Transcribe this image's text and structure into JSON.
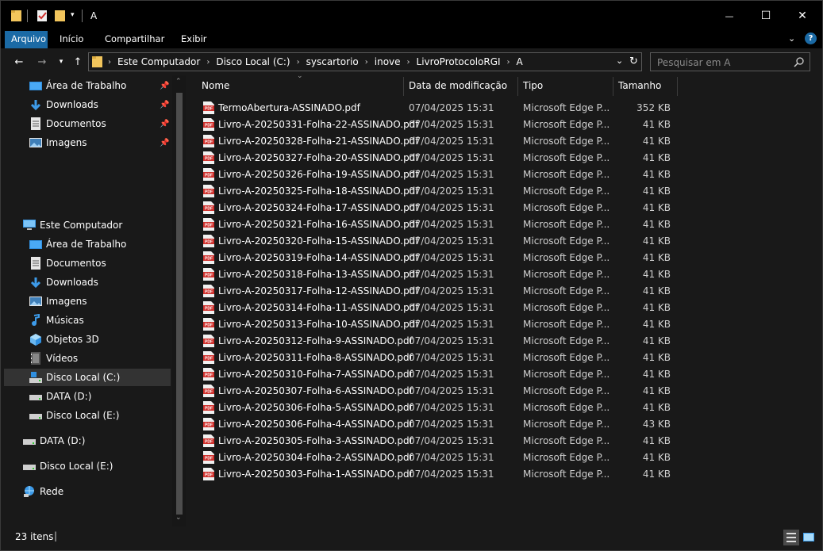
{
  "window": {
    "title": "A",
    "minimize_glyph": "—",
    "maximize_glyph": "☐",
    "close_glyph": "✕"
  },
  "ribbon": {
    "tabs": [
      {
        "label": "Arquivo",
        "active": true
      },
      {
        "label": "Início",
        "active": false
      },
      {
        "label": "Compartilhar",
        "active": false
      },
      {
        "label": "Exibir",
        "active": false
      }
    ]
  },
  "nav": {
    "breadcrumbs": [
      "Este Computador",
      "Disco Local (C:)",
      "syscartorio",
      "inove",
      "LivroProtocoloRGI",
      "A"
    ],
    "search_placeholder": "Pesquisar em A"
  },
  "sidebar": {
    "quick_access": [
      {
        "label": "Área de Trabalho",
        "icon": "desktop-icon",
        "pinned": true
      },
      {
        "label": "Downloads",
        "icon": "download-icon",
        "pinned": true
      },
      {
        "label": "Documentos",
        "icon": "documents-icon",
        "pinned": true
      },
      {
        "label": "Imagens",
        "icon": "pictures-icon",
        "pinned": true
      }
    ],
    "this_pc": {
      "label": "Este Computador",
      "icon": "computer-icon"
    },
    "this_pc_items": [
      {
        "label": "Área de Trabalho",
        "icon": "desktop-icon"
      },
      {
        "label": "Documentos",
        "icon": "documents-icon"
      },
      {
        "label": "Downloads",
        "icon": "download-icon"
      },
      {
        "label": "Imagens",
        "icon": "pictures-icon"
      },
      {
        "label": "Músicas",
        "icon": "music-icon"
      },
      {
        "label": "Objetos 3D",
        "icon": "objects-3d-icon"
      },
      {
        "label": "Vídeos",
        "icon": "videos-icon"
      },
      {
        "label": "Disco Local (C:)",
        "icon": "drive-os-icon",
        "selected": true
      },
      {
        "label": "DATA (D:)",
        "icon": "drive-icon"
      },
      {
        "label": "Disco Local (E:)",
        "icon": "drive-icon"
      }
    ],
    "roots": [
      {
        "label": "DATA (D:)",
        "icon": "drive-icon"
      },
      {
        "label": "Disco Local (E:)",
        "icon": "drive-icon"
      },
      {
        "label": "Rede",
        "icon": "network-icon"
      }
    ]
  },
  "columns": {
    "name": "Nome",
    "date": "Data de modificação",
    "type": "Tipo",
    "size": "Tamanho"
  },
  "files": [
    {
      "name": "TermoAbertura-ASSINADO.pdf",
      "date": "07/04/2025 15:31",
      "type": "Microsoft Edge P...",
      "size": "352 KB"
    },
    {
      "name": "Livro-A-20250331-Folha-22-ASSINADO.pdf",
      "date": "07/04/2025 15:31",
      "type": "Microsoft Edge P...",
      "size": "41 KB"
    },
    {
      "name": "Livro-A-20250328-Folha-21-ASSINADO.pdf",
      "date": "07/04/2025 15:31",
      "type": "Microsoft Edge P...",
      "size": "41 KB"
    },
    {
      "name": "Livro-A-20250327-Folha-20-ASSINADO.pdf",
      "date": "07/04/2025 15:31",
      "type": "Microsoft Edge P...",
      "size": "41 KB"
    },
    {
      "name": "Livro-A-20250326-Folha-19-ASSINADO.pdf",
      "date": "07/04/2025 15:31",
      "type": "Microsoft Edge P...",
      "size": "41 KB"
    },
    {
      "name": "Livro-A-20250325-Folha-18-ASSINADO.pdf",
      "date": "07/04/2025 15:31",
      "type": "Microsoft Edge P...",
      "size": "41 KB"
    },
    {
      "name": "Livro-A-20250324-Folha-17-ASSINADO.pdf",
      "date": "07/04/2025 15:31",
      "type": "Microsoft Edge P...",
      "size": "41 KB"
    },
    {
      "name": "Livro-A-20250321-Folha-16-ASSINADO.pdf",
      "date": "07/04/2025 15:31",
      "type": "Microsoft Edge P...",
      "size": "41 KB"
    },
    {
      "name": "Livro-A-20250320-Folha-15-ASSINADO.pdf",
      "date": "07/04/2025 15:31",
      "type": "Microsoft Edge P...",
      "size": "41 KB"
    },
    {
      "name": "Livro-A-20250319-Folha-14-ASSINADO.pdf",
      "date": "07/04/2025 15:31",
      "type": "Microsoft Edge P...",
      "size": "41 KB"
    },
    {
      "name": "Livro-A-20250318-Folha-13-ASSINADO.pdf",
      "date": "07/04/2025 15:31",
      "type": "Microsoft Edge P...",
      "size": "41 KB"
    },
    {
      "name": "Livro-A-20250317-Folha-12-ASSINADO.pdf",
      "date": "07/04/2025 15:31",
      "type": "Microsoft Edge P...",
      "size": "41 KB"
    },
    {
      "name": "Livro-A-20250314-Folha-11-ASSINADO.pdf",
      "date": "07/04/2025 15:31",
      "type": "Microsoft Edge P...",
      "size": "41 KB"
    },
    {
      "name": "Livro-A-20250313-Folha-10-ASSINADO.pdf",
      "date": "07/04/2025 15:31",
      "type": "Microsoft Edge P...",
      "size": "41 KB"
    },
    {
      "name": "Livro-A-20250312-Folha-9-ASSINADO.pdf",
      "date": "07/04/2025 15:31",
      "type": "Microsoft Edge P...",
      "size": "41 KB"
    },
    {
      "name": "Livro-A-20250311-Folha-8-ASSINADO.pdf",
      "date": "07/04/2025 15:31",
      "type": "Microsoft Edge P...",
      "size": "41 KB"
    },
    {
      "name": "Livro-A-20250310-Folha-7-ASSINADO.pdf",
      "date": "07/04/2025 15:31",
      "type": "Microsoft Edge P...",
      "size": "41 KB"
    },
    {
      "name": "Livro-A-20250307-Folha-6-ASSINADO.pdf",
      "date": "07/04/2025 15:31",
      "type": "Microsoft Edge P...",
      "size": "41 KB"
    },
    {
      "name": "Livro-A-20250306-Folha-5-ASSINADO.pdf",
      "date": "07/04/2025 15:31",
      "type": "Microsoft Edge P...",
      "size": "41 KB"
    },
    {
      "name": "Livro-A-20250306-Folha-4-ASSINADO.pdf",
      "date": "07/04/2025 15:31",
      "type": "Microsoft Edge P...",
      "size": "43 KB"
    },
    {
      "name": "Livro-A-20250305-Folha-3-ASSINADO.pdf",
      "date": "07/04/2025 15:31",
      "type": "Microsoft Edge P...",
      "size": "41 KB"
    },
    {
      "name": "Livro-A-20250304-Folha-2-ASSINADO.pdf",
      "date": "07/04/2025 15:31",
      "type": "Microsoft Edge P...",
      "size": "41 KB"
    },
    {
      "name": "Livro-A-20250303-Folha-1-ASSINADO.pdf",
      "date": "07/04/2025 15:31",
      "type": "Microsoft Edge P...",
      "size": "41 KB"
    }
  ],
  "status": {
    "item_count": "23 itens"
  },
  "colors": {
    "accent": "#1b6aa5",
    "folder": "#f2c55c",
    "pdf_red": "#d0312d"
  }
}
